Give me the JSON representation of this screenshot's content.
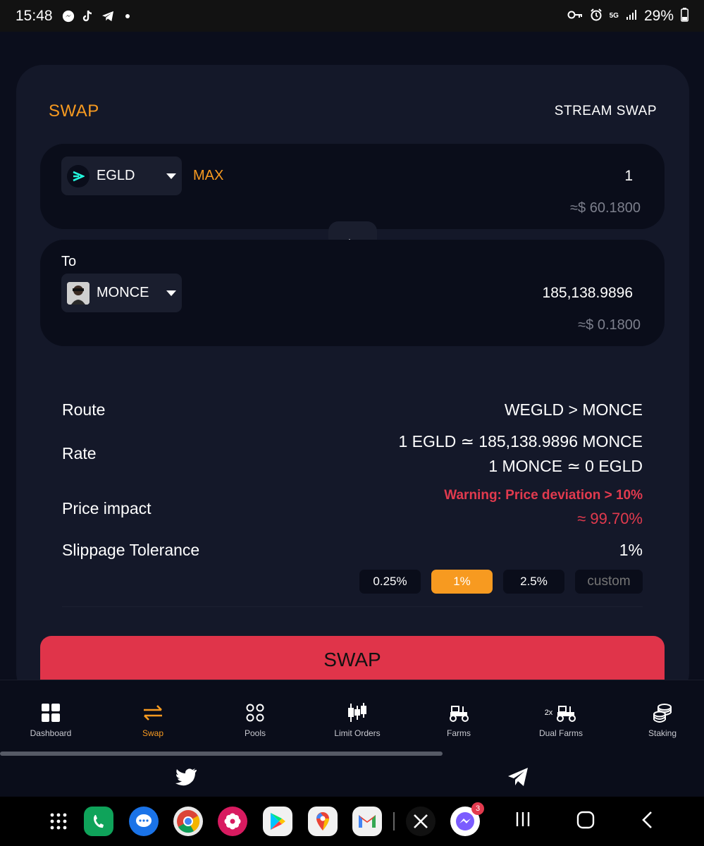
{
  "status_bar": {
    "time": "15:48",
    "notification_icons": [
      "messenger-icon",
      "tiktok-icon",
      "telegram-icon",
      "dot-icon"
    ],
    "system_icons": [
      "key-icon",
      "alarm-icon",
      "5g-icon",
      "signal-icon"
    ],
    "network": "5G",
    "battery": "29%"
  },
  "swap_card": {
    "title": "SWAP",
    "stream_swap_label": "STREAM SWAP",
    "from": {
      "token": "EGLD",
      "max_label": "MAX",
      "amount": "1",
      "usd_value": "≈$ 60.1800"
    },
    "to": {
      "label": "To",
      "token": "MONCE",
      "amount": "185,138.9896",
      "usd_value": "≈$ 0.1800"
    },
    "details": {
      "route_label": "Route",
      "route_value": "WEGLD > MONCE",
      "rate_label": "Rate",
      "rate_line1": "1 EGLD ≃ 185,138.9896 MONCE",
      "rate_line2": "1 MONCE ≃ 0 EGLD",
      "price_impact_label": "Price impact",
      "price_impact_warning": "Warning: Price deviation > 10%",
      "price_impact_value": "≈ 99.70%",
      "slippage_label": "Slippage Tolerance",
      "slippage_value": "1%",
      "slippage_options": [
        "0.25%",
        "1%",
        "2.5%"
      ],
      "slippage_selected": "1%",
      "custom_placeholder": "custom"
    },
    "swap_button_label": "SWAP"
  },
  "bottom_nav": {
    "items": [
      {
        "label": "Dashboard",
        "icon": "dashboard-icon"
      },
      {
        "label": "Swap",
        "icon": "swap-arrows-icon"
      },
      {
        "label": "Pools",
        "icon": "pools-icon"
      },
      {
        "label": "Limit Orders",
        "icon": "candlestick-icon"
      },
      {
        "label": "Farms",
        "icon": "tractor-icon"
      },
      {
        "label": "Dual Farms",
        "icon": "dual-tractor-icon",
        "prefix": "2x"
      },
      {
        "label": "Staking",
        "icon": "coins-stack-icon"
      }
    ],
    "active": "Swap"
  },
  "social": [
    "twitter-icon",
    "telegram-icon"
  ],
  "taskbar": {
    "apps": [
      "apps-grid-icon",
      "phone-icon",
      "messages-icon",
      "chrome-icon",
      "flower-icon",
      "play-store-icon",
      "maps-icon",
      "gmail-icon",
      "x-icon",
      "messenger-icon"
    ],
    "messenger_badge": "3"
  },
  "colors": {
    "accent": "#f79a20",
    "danger": "#e23a4e",
    "card_bg": "#141829",
    "page_bg": "#0b0e1c",
    "input_bg": "#0a0d1a"
  }
}
